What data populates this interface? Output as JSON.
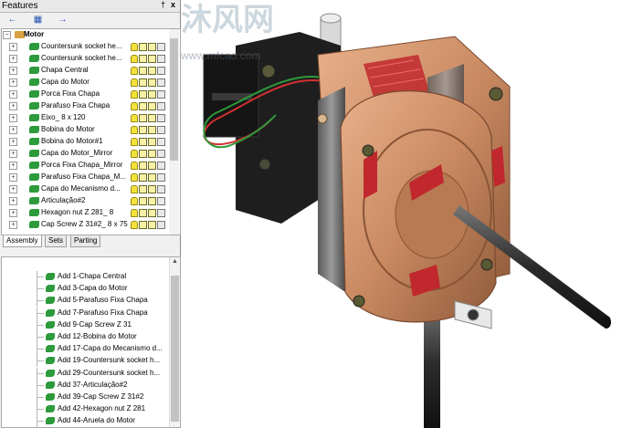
{
  "panel": {
    "title": "Features",
    "pin_glyph": "†",
    "close_glyph": "x"
  },
  "watermark": {
    "text": "沐风网",
    "url": "www.mfcad.com"
  },
  "tree": {
    "root_label": "Motor",
    "items": [
      {
        "label": "Countersunk socket he..."
      },
      {
        "label": "Countersunk socket he..."
      },
      {
        "label": "Chapa Central"
      },
      {
        "label": "Capa do Motor"
      },
      {
        "label": "Porca Fixa Chapa"
      },
      {
        "label": "Parafuso Fixa Chapa"
      },
      {
        "label": "Eixo_ 8 x 120"
      },
      {
        "label": "Bobina do Motor"
      },
      {
        "label": "Bobina do Motor#1"
      },
      {
        "label": "Capa do Motor_Mirror"
      },
      {
        "label": "Porca Fixa Chapa_Mirror"
      },
      {
        "label": "Parafuso Fixa Chapa_M..."
      },
      {
        "label": "Capa do Mecanismo d..."
      },
      {
        "label": "Articulação#2"
      },
      {
        "label": "Hexagon nut Z 281_ 8"
      },
      {
        "label": "Cap Screw Z 31#2_ 8 x 75"
      }
    ]
  },
  "tabs": [
    {
      "label": "Assembly"
    },
    {
      "label": "Sets"
    },
    {
      "label": "Parting"
    }
  ],
  "history": {
    "items": [
      {
        "label": "Add 1-Chapa Central"
      },
      {
        "label": "Add 3-Capa do Motor"
      },
      {
        "label": "Add 5-Parafuso Fixa Chapa"
      },
      {
        "label": "Add 7-Parafuso Fixa Chapa"
      },
      {
        "label": "Add 9-Cap Screw Z 31"
      },
      {
        "label": "Add 12-Bobina do Motor"
      },
      {
        "label": "Add 17-Capa do Mecanismo d..."
      },
      {
        "label": "Add 19-Countersunk socket h..."
      },
      {
        "label": "Add 29-Countersunk socket h..."
      },
      {
        "label": "Add 37-Articulação#2"
      },
      {
        "label": "Add 39-Cap Screw Z 31#2"
      },
      {
        "label": "Add 42-Hexagon nut Z 281"
      },
      {
        "label": "Add 44-Aruela do Motor"
      }
    ]
  },
  "colors": {
    "copper": "#c98a62",
    "copper_dark": "#8f5a3a",
    "coil_red": "#d8343a",
    "shaft": "#3a3a3a",
    "tree_icon_green": "#2d9a3c"
  }
}
